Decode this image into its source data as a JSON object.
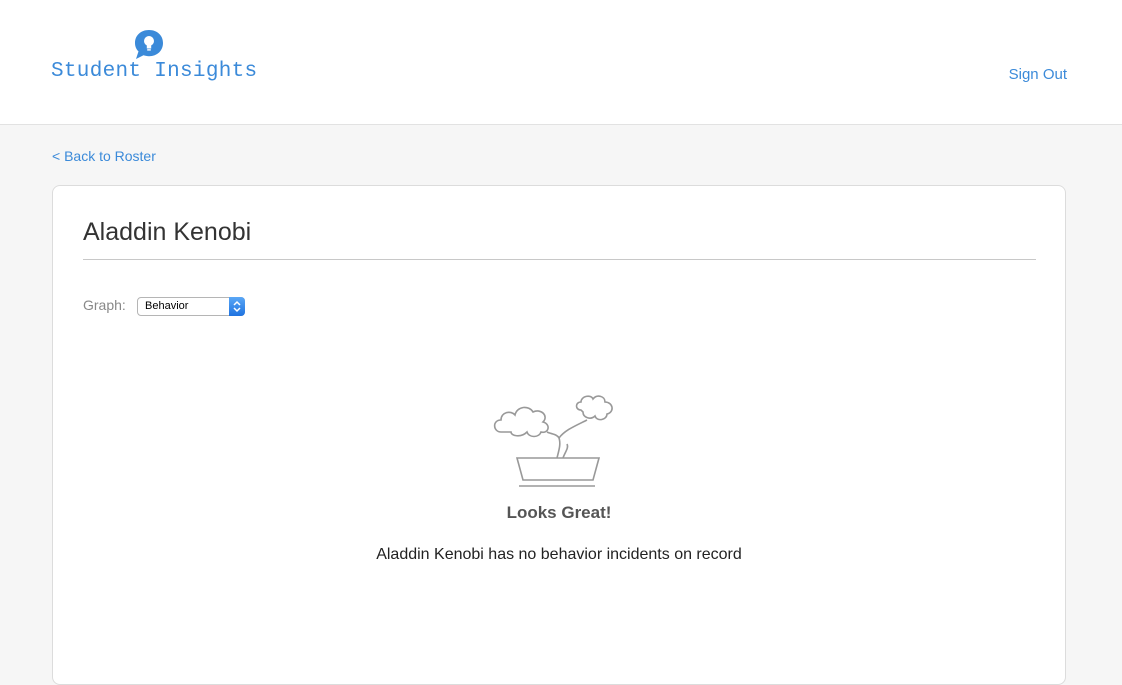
{
  "header": {
    "app_name": "Student Insights",
    "logo_icon": "lightbulb-chat-icon",
    "sign_out_label": "Sign Out"
  },
  "nav": {
    "back_label": "< Back to Roster"
  },
  "student": {
    "name": "Aladdin Kenobi"
  },
  "graph": {
    "label": "Graph:",
    "selected": "Behavior",
    "arrow_icon": "updown-chevron-icon"
  },
  "empty_state": {
    "illustration": "bonsai-tree-icon",
    "title": "Looks Great!",
    "message": "Aladdin Kenobi has no behavior incidents on record"
  },
  "colors": {
    "accent": "#3b8ad9",
    "background": "#f6f6f6",
    "card": "#ffffff"
  }
}
